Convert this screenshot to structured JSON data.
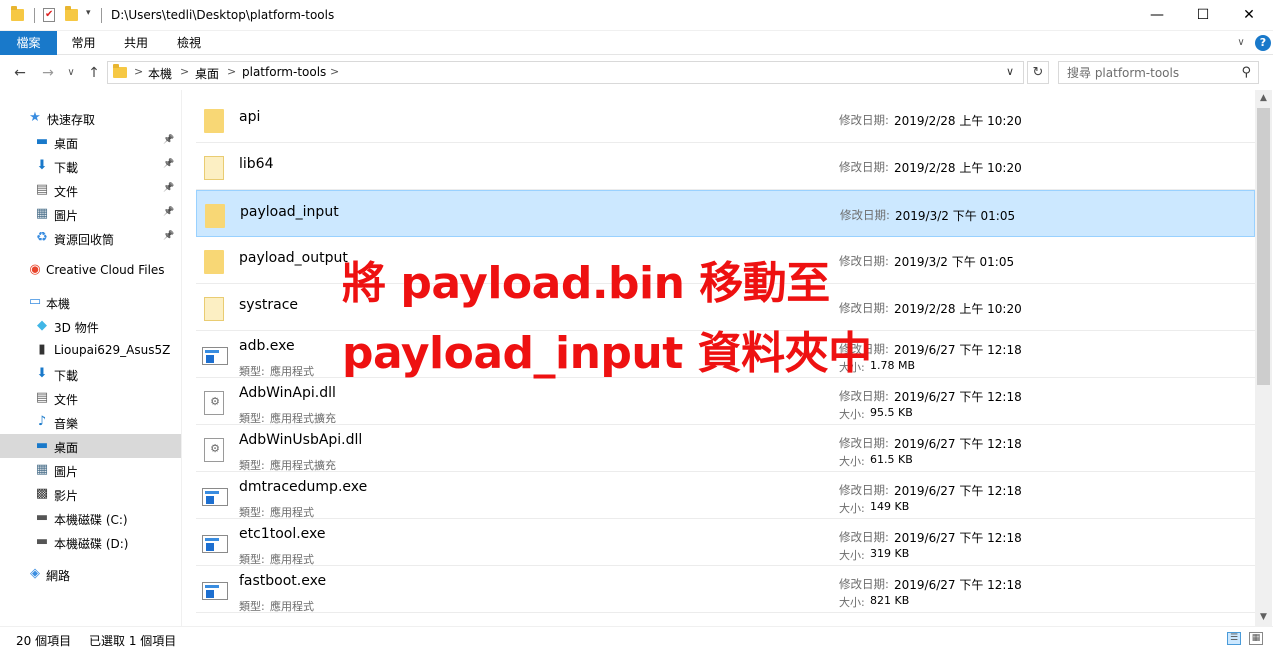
{
  "window": {
    "title": "D:\\Users\\tedli\\Desktop\\platform-tools",
    "minimize_glyph": "—",
    "maximize_glyph": "☐",
    "close_glyph": "✕"
  },
  "ribbon": {
    "tabs": [
      "檔案",
      "常用",
      "共用",
      "檢視"
    ],
    "expand_glyph": "?",
    "collapse_glyph": "∨"
  },
  "nav": {
    "back_glyph": "←",
    "forward_glyph": "→",
    "recent_glyph": "∨",
    "up_glyph": "↑"
  },
  "address": {
    "crumbs": [
      "本機",
      "桌面",
      "platform-tools"
    ],
    "separator": ">",
    "dropdown_glyph": "∨",
    "refresh_glyph": "↻"
  },
  "search": {
    "placeholder": "搜尋 platform-tools",
    "icon_glyph": "⚲"
  },
  "sidebar": {
    "items": [
      {
        "label": "快速存取",
        "icon": "star-icon",
        "glyph": "★",
        "color": "#3a8de0",
        "pinned": false,
        "selected": false
      },
      {
        "label": "桌面",
        "icon": "desktop-icon",
        "glyph": "▬",
        "color": "#1979ca",
        "pinned": true,
        "selected": false
      },
      {
        "label": "下載",
        "icon": "download-icon",
        "glyph": "⬇",
        "color": "#1979ca",
        "pinned": true,
        "selected": false
      },
      {
        "label": "文件",
        "icon": "document-icon",
        "glyph": "▤",
        "color": "#666666",
        "pinned": true,
        "selected": false
      },
      {
        "label": "圖片",
        "icon": "pictures-icon",
        "glyph": "▦",
        "color": "#4a6f8a",
        "pinned": true,
        "selected": false
      },
      {
        "label": "資源回收筒",
        "icon": "recycle-bin-icon",
        "glyph": "♻",
        "color": "#3a8de0",
        "pinned": true,
        "selected": false
      },
      {
        "label": "Creative Cloud Files",
        "icon": "creative-cloud-icon",
        "glyph": "◉",
        "color": "#e8452c",
        "pinned": false,
        "selected": false
      },
      {
        "label": "本機",
        "icon": "computer-icon",
        "glyph": "▭",
        "color": "#3a8de0",
        "pinned": false,
        "selected": false
      },
      {
        "label": "3D 物件",
        "icon": "3d-objects-icon",
        "glyph": "◆",
        "color": "#41b6e6",
        "pinned": false,
        "selected": false
      },
      {
        "label": "Lioupai629_Asus5Z",
        "icon": "phone-icon",
        "glyph": "▮",
        "color": "#333333",
        "pinned": false,
        "selected": false
      },
      {
        "label": "下載",
        "icon": "download-icon",
        "glyph": "⬇",
        "color": "#1979ca",
        "pinned": false,
        "selected": false
      },
      {
        "label": "文件",
        "icon": "document-icon",
        "glyph": "▤",
        "color": "#666666",
        "pinned": false,
        "selected": false
      },
      {
        "label": "音樂",
        "icon": "music-icon",
        "glyph": "♪",
        "color": "#1979ca",
        "pinned": false,
        "selected": false
      },
      {
        "label": "桌面",
        "icon": "desktop-icon",
        "glyph": "▬",
        "color": "#1979ca",
        "pinned": false,
        "selected": true
      },
      {
        "label": "圖片",
        "icon": "pictures-icon",
        "glyph": "▦",
        "color": "#4a6f8a",
        "pinned": false,
        "selected": false
      },
      {
        "label": "影片",
        "icon": "videos-icon",
        "glyph": "▩",
        "color": "#333333",
        "pinned": false,
        "selected": false
      },
      {
        "label": "本機磁碟 (C:)",
        "icon": "drive-c-icon",
        "glyph": "▬",
        "color": "#555555",
        "pinned": false,
        "selected": false
      },
      {
        "label": "本機磁碟 (D:)",
        "icon": "drive-d-icon",
        "glyph": "▬",
        "color": "#555555",
        "pinned": false,
        "selected": false
      },
      {
        "label": "網路",
        "icon": "network-icon",
        "glyph": "◈",
        "color": "#3a8de0",
        "pinned": false,
        "selected": false
      }
    ],
    "pin_glyph": "📌"
  },
  "files": {
    "date_label": "修改日期:",
    "type_label": "類型:",
    "size_label": "大小:",
    "rows": [
      {
        "name": "api",
        "kind": "folder",
        "date": "2019/2/28 上午 10:20",
        "type": "",
        "size": "",
        "selected": false
      },
      {
        "name": "lib64",
        "kind": "folder-plain",
        "date": "2019/2/28 上午 10:20",
        "type": "",
        "size": "",
        "selected": false
      },
      {
        "name": "payload_input",
        "kind": "folder",
        "date": "2019/3/2 下午 01:05",
        "type": "",
        "size": "",
        "selected": true
      },
      {
        "name": "payload_output",
        "kind": "folder",
        "date": "2019/3/2 下午 01:05",
        "type": "",
        "size": "",
        "selected": false
      },
      {
        "name": "systrace",
        "kind": "folder-plain",
        "date": "2019/2/28 上午 10:20",
        "type": "",
        "size": "",
        "selected": false
      },
      {
        "name": "adb.exe",
        "kind": "exe",
        "date": "2019/6/27 下午 12:18",
        "type": "應用程式",
        "size": "1.78 MB",
        "selected": false
      },
      {
        "name": "AdbWinApi.dll",
        "kind": "dll",
        "date": "2019/6/27 下午 12:18",
        "type": "應用程式擴充",
        "size": "95.5 KB",
        "selected": false
      },
      {
        "name": "AdbWinUsbApi.dll",
        "kind": "dll",
        "date": "2019/6/27 下午 12:18",
        "type": "應用程式擴充",
        "size": "61.5 KB",
        "selected": false
      },
      {
        "name": "dmtracedump.exe",
        "kind": "exe",
        "date": "2019/6/27 下午 12:18",
        "type": "應用程式",
        "size": "149 KB",
        "selected": false
      },
      {
        "name": "etc1tool.exe",
        "kind": "exe",
        "date": "2019/6/27 下午 12:18",
        "type": "應用程式",
        "size": "319 KB",
        "selected": false
      },
      {
        "name": "fastboot.exe",
        "kind": "exe",
        "date": "2019/6/27 下午 12:18",
        "type": "應用程式",
        "size": "821 KB",
        "selected": false
      }
    ]
  },
  "scrollbar": {
    "up_glyph": "▲",
    "down_glyph": "▼"
  },
  "status": {
    "item_count": "20 個項目",
    "selected_count": "已選取 1 個項目",
    "details_view_glyph": "☰",
    "icons_view_glyph": "▦"
  },
  "overlay": {
    "line1": "將 payload.bin 移動至",
    "line2": "payload_input 資料夾中",
    "color": "#ee1111"
  }
}
